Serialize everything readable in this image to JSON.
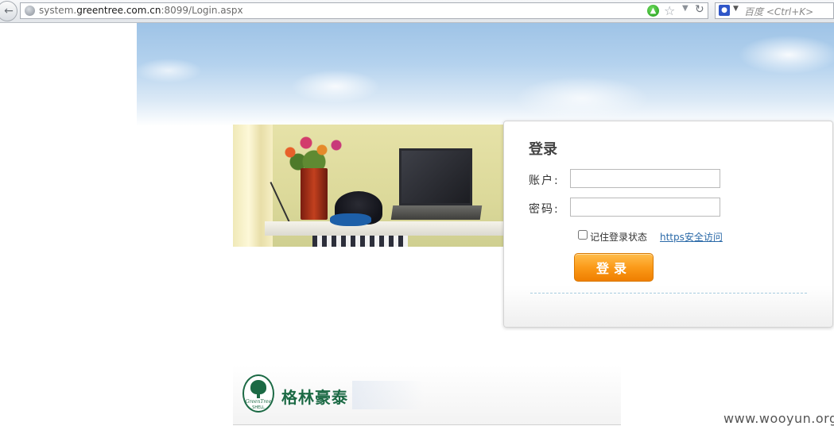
{
  "browser": {
    "url_prefix": "system.",
    "url_domain": "greentree.com.cn",
    "url_suffix": ":8099/Login.aspx",
    "search_placeholder": "百度 <Ctrl+K>"
  },
  "login": {
    "title": "登录",
    "account_label": "账户:",
    "password_label": "密码:",
    "account_value": "",
    "password_value": "",
    "remember_label": "记住登录状态",
    "remember_checked": false,
    "https_link": "https安全访问",
    "submit_label": "登录"
  },
  "brand": {
    "emblem_line1": "GreenTree",
    "emblem_line2": "SHELL",
    "name": "格林豪泰",
    "color": "#1c6a45"
  },
  "watermark": "www.wooyun.org",
  "colors": {
    "button_orange": "#fb9a19",
    "link_blue": "#2b6aa8"
  }
}
